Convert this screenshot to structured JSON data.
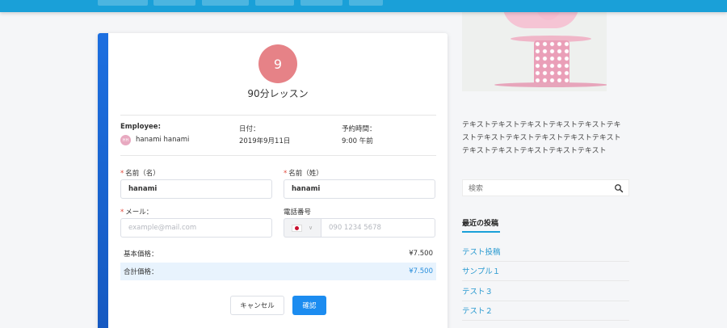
{
  "booking": {
    "service_number": "9",
    "service_name": "90分レッスン",
    "employee_label": "Employee:",
    "employee_initials": "HH",
    "employee_name": "hanami hanami",
    "date_label": "日付：",
    "date_value": "2019年9月11日",
    "time_label": "予約時間：",
    "time_value": "9:00 午前",
    "first_name_label": "名前（名）",
    "first_name_value": "hanami",
    "last_name_label": "名前（姓）",
    "last_name_value": "hanami",
    "email_label": "メール：",
    "email_placeholder": "example@mail.com",
    "phone_label": "電話番号",
    "phone_placeholder": "090 1234 5678",
    "required_mark": "*",
    "base_price_label": "基本価格：",
    "base_price_value": "¥7.500",
    "total_price_label": "合計価格：",
    "total_price_value": "¥7.500",
    "cancel_label": "キャンセル",
    "confirm_label": "確認",
    "accent_color": "#1c8cf0"
  },
  "sidebar": {
    "text": "テキストテキストテキストテキストテキストテキストテキストテキストテキストテキストテキストテキストテキストテキストテキストテキスト",
    "search_placeholder": "検索",
    "recent_title": "最近の投稿",
    "recent_posts": [
      "テスト投稿",
      "サンプル１",
      "テスト３",
      "テスト２"
    ]
  },
  "icons": {
    "search": "search-icon",
    "chevron": "chevron-down-icon",
    "flag": "japan-flag-icon"
  }
}
